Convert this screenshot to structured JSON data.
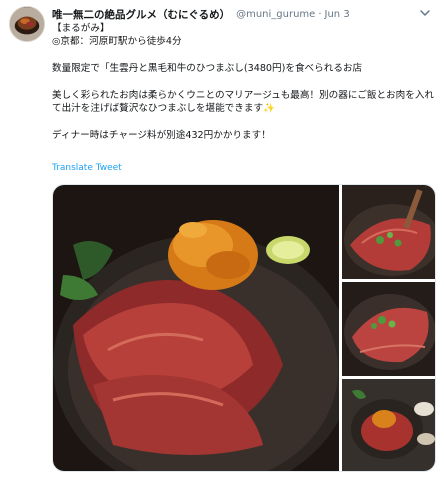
{
  "tweet": {
    "display_name": "唯一無二の絶品グルメ（むにぐるめ）",
    "handle": "@muni_gurume",
    "separator": "·",
    "date": "Jun 3",
    "lines": {
      "l1": "【まるがみ】",
      "l2": "◎京都：河原町駅から徒歩4分",
      "l3": "数量限定で「生雲丹と黒毛和牛のひつまぶし(3480円)を食べられるお店",
      "l4": "美しく彩られたお肉は柔らかくウニとのマリアージュも最高！別の器にご飯とお肉を入れて出汁を注げば贅沢なひつまぶしを堪能できます",
      "l4_emoji": "✨",
      "l5": "ディナー時はチャージ料が別途432円かかります！"
    },
    "translate_label": "Translate Tweet",
    "colors": {
      "link": "#1da1f2",
      "muted": "#657786",
      "text": "#14171a"
    }
  }
}
